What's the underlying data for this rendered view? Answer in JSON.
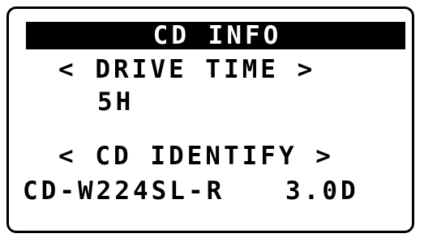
{
  "screen": {
    "title": "CD INFO",
    "drive_time": {
      "label": "< DRIVE TIME >",
      "value": "5H"
    },
    "cd_identify": {
      "label": "< CD IDENTIFY >",
      "model": "CD-W224SL-R",
      "version": "3.0D"
    }
  },
  "colors": {
    "foreground": "#000000",
    "background": "#ffffff",
    "title_text": "#ffffff"
  }
}
